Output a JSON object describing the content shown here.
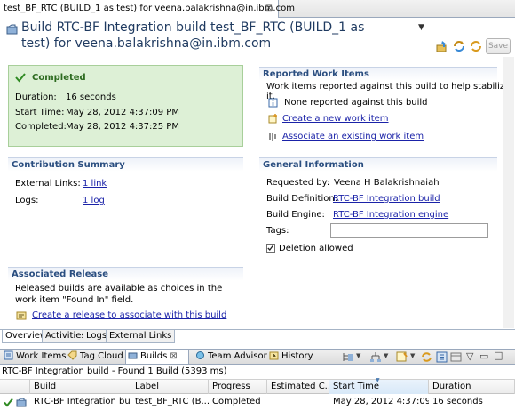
{
  "editor": {
    "tab_title": "test_BF_RTC (BUILD_1 as test) for veena.balakrishna@in.ibm.com",
    "close_glyph": "⊠",
    "header_title": "Build RTC-BF Integration build test_BF_RTC (BUILD_1 as test) for veena.balakrishna@in.ibm.com",
    "dropdown_glyph": "▼",
    "save_label": "Save"
  },
  "status": {
    "title": "Completed",
    "rows": [
      {
        "label": "Duration:",
        "value": "16 seconds"
      },
      {
        "label": "Start Time:",
        "value": "May 28, 2012 4:37:09 PM"
      },
      {
        "label": "Completed:",
        "value": "May 28, 2012 4:37:25 PM"
      }
    ]
  },
  "contribution": {
    "title": "Contribution Summary",
    "rows": [
      {
        "label": "External Links:",
        "value": "1 link"
      },
      {
        "label": "Logs:",
        "value": "1 log"
      }
    ]
  },
  "associated_release": {
    "title": "Associated Release",
    "description": "Released builds are available as choices in the work item \"Found In\" field.",
    "link": "Create a release to associate with this build"
  },
  "reported": {
    "title": "Reported Work Items",
    "description": "Work items reported against this build to help stabilize it.",
    "none_text": "None reported against this build",
    "create_link": "Create a new work item",
    "associate_link": "Associate an existing work item"
  },
  "general": {
    "title": "General Information",
    "requested_by_label": "Requested by:",
    "requested_by_value": "Veena H Balakrishnaiah",
    "definition_label": "Build Definition:",
    "definition_value": "RTC-BF Integration build",
    "engine_label": "Build Engine:",
    "engine_value": "RTC-BF Integration engine",
    "tags_label": "Tags:",
    "tags_value": "",
    "deletion_label": "Deletion allowed",
    "deletion_checked": true
  },
  "editor_tabs": [
    "Overview",
    "Activities",
    "Logs",
    "External Links"
  ],
  "views": {
    "tabs": [
      "Work Items",
      "Tag Cloud",
      "Builds",
      "Team Advisor",
      "History"
    ],
    "active": "Builds",
    "status_line": "RTC-BF Integration build - Found 1 Build (5393 ms)"
  },
  "table": {
    "columns": [
      "Build",
      "Label",
      "Progress",
      "Estimated C...",
      "Start Time",
      "Duration"
    ],
    "sorted_column": "Start Time",
    "rows": [
      {
        "build": "RTC-BF Integration bu...",
        "label": "test_BF_RTC (B...",
        "progress": "Completed",
        "estimated": "",
        "start": "May 28, 2012 4:37:09 ...",
        "duration": "16 seconds"
      }
    ]
  },
  "colors": {
    "completed_bg": "#ddf0d6",
    "section_title": "#2a4e80",
    "link": "#1a22a8",
    "header_title": "#1f3a60"
  }
}
